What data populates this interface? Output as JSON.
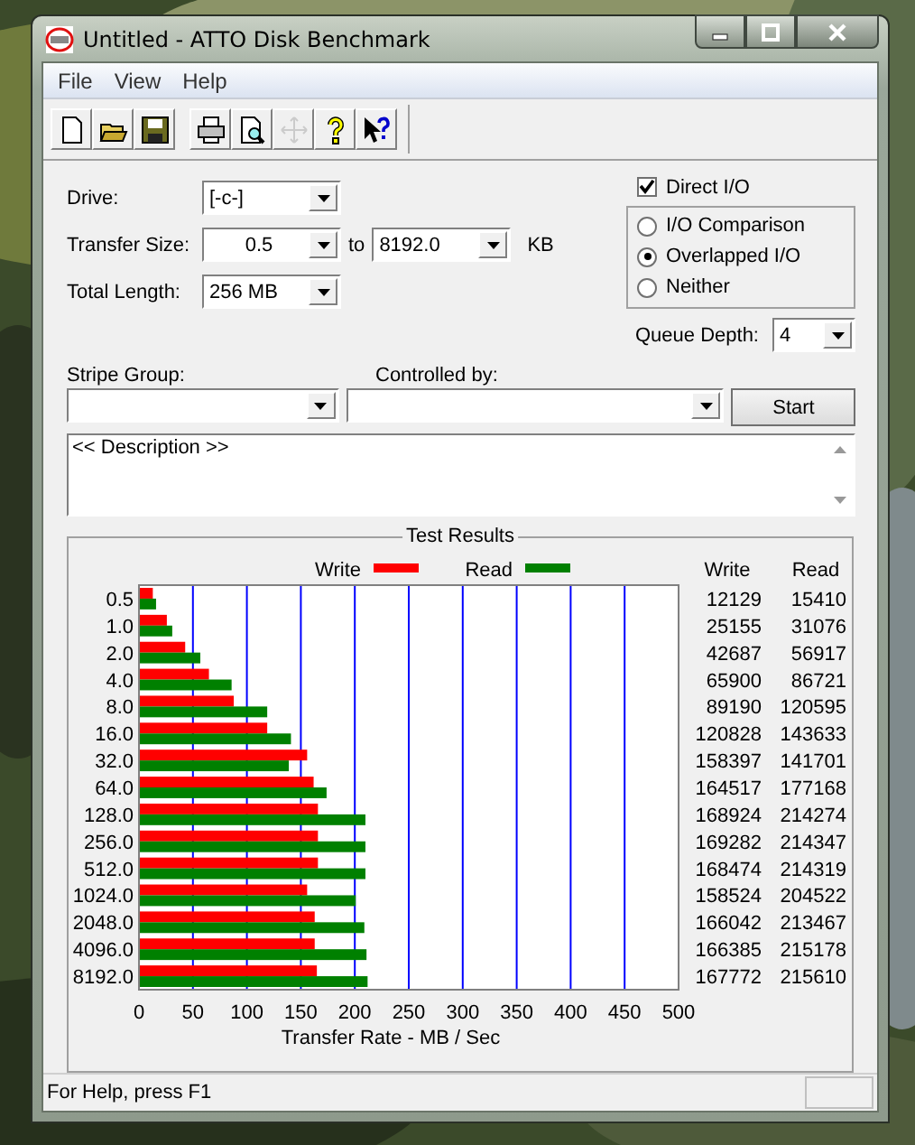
{
  "window": {
    "title": "Untitled - ATTO Disk Benchmark"
  },
  "menu": [
    {
      "label": "File"
    },
    {
      "label": "View"
    },
    {
      "label": "Help"
    }
  ],
  "toolbar": [
    {
      "kind": "new",
      "disabled": false
    },
    {
      "kind": "open",
      "disabled": false
    },
    {
      "kind": "save",
      "disabled": false
    },
    {
      "kind": "print",
      "disabled": false
    },
    {
      "kind": "preview",
      "disabled": false
    },
    {
      "kind": "move",
      "disabled": true
    },
    {
      "kind": "help",
      "disabled": false
    },
    {
      "kind": "context-help",
      "disabled": false
    }
  ],
  "drive": {
    "label": "Drive:",
    "value": "[-c-]"
  },
  "transfer_size": {
    "label": "Transfer Size:",
    "from": "0.5",
    "to_label": "to",
    "to": "8192.0",
    "unit": "KB"
  },
  "total_length": {
    "label": "Total Length:",
    "value": "256 MB"
  },
  "direct_io": {
    "label": "Direct I/O",
    "checked": true
  },
  "io_modes": [
    {
      "label": "I/O Comparison",
      "selected": false
    },
    {
      "label": "Overlapped I/O",
      "selected": true
    },
    {
      "label": "Neither",
      "selected": false
    }
  ],
  "queue_depth": {
    "label": "Queue Depth:",
    "value": "4"
  },
  "stripe_group": {
    "label": "Stripe Group:"
  },
  "controlled_by": {
    "label": "Controlled by:"
  },
  "start_button": "Start",
  "description": "<< Description >>",
  "test_results": {
    "title": "Test Results",
    "columns": [
      "Write",
      "Read"
    ],
    "rows": [
      {
        "write": "12129",
        "read": "15410"
      },
      {
        "write": "25155",
        "read": "31076"
      },
      {
        "write": "42687",
        "read": "56917"
      },
      {
        "write": "65900",
        "read": "86721"
      },
      {
        "write": "89190",
        "read": "120595"
      },
      {
        "write": "120828",
        "read": "143633"
      },
      {
        "write": "158397",
        "read": "141701"
      },
      {
        "write": "164517",
        "read": "177168"
      },
      {
        "write": "168924",
        "read": "214274"
      },
      {
        "write": "169282",
        "read": "214347"
      },
      {
        "write": "168474",
        "read": "214319"
      },
      {
        "write": "158524",
        "read": "204522"
      },
      {
        "write": "166042",
        "read": "213467"
      },
      {
        "write": "166385",
        "read": "215178"
      },
      {
        "write": "167772",
        "read": "215610"
      }
    ],
    "chart_data": {
      "type": "bar",
      "orientation": "horizontal",
      "xlabel": "Transfer Rate - MB / Sec",
      "categories": [
        "0.5",
        "1.0",
        "2.0",
        "4.0",
        "8.0",
        "16.0",
        "32.0",
        "64.0",
        "128.0",
        "256.0",
        "512.0",
        "1024.0",
        "2048.0",
        "4096.0",
        "8192.0"
      ],
      "series": [
        {
          "name": "Write",
          "color": "#ff0000",
          "values": [
            12,
            25,
            42,
            64,
            87,
            118,
            155,
            161,
            165,
            165,
            165,
            155,
            162,
            162,
            164
          ]
        },
        {
          "name": "Read",
          "color": "#008000",
          "values": [
            15,
            30,
            56,
            85,
            118,
            140,
            138,
            173,
            209,
            209,
            209,
            200,
            208,
            210,
            211
          ]
        }
      ],
      "grid": true,
      "legend": true,
      "xlim": [
        0,
        500
      ],
      "xticks": [
        0,
        50,
        100,
        150,
        200,
        250,
        300,
        350,
        400,
        450,
        500
      ]
    }
  },
  "status_bar": "For Help, press F1"
}
